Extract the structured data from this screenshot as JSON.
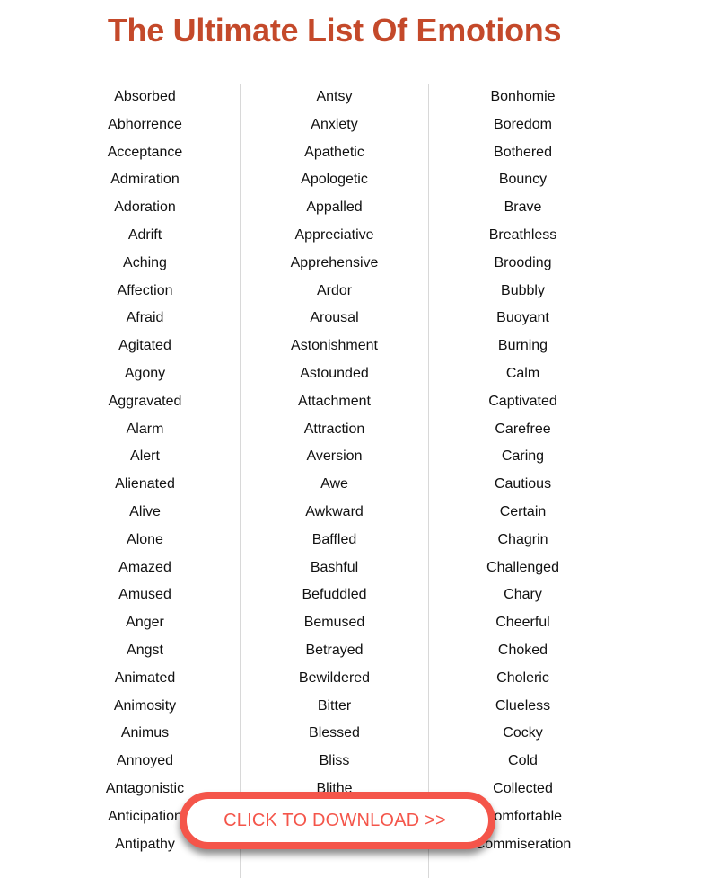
{
  "header": {
    "title": "The Ultimate List Of Emotions",
    "title_color": "#C4492A"
  },
  "columns": [
    {
      "words": [
        "Absorbed",
        "Abhorrence",
        "Acceptance",
        "Admiration",
        "Adoration",
        "Adrift",
        "Aching",
        "Affection",
        "Afraid",
        "Agitated",
        "Agony",
        "Aggravated",
        "Alarm",
        "Alert",
        "Alienated",
        "Alive",
        "Alone",
        "Amazed",
        "Amused",
        "Anger",
        "Angst",
        "Animated",
        "Animosity",
        "Animus",
        "Annoyed",
        "Antagonistic",
        "Anticipation",
        "Antipathy"
      ]
    },
    {
      "words": [
        "Antsy",
        "Anxiety",
        "Apathetic",
        "Apologetic",
        "Appalled",
        "Appreciative",
        "Apprehensive",
        "Ardor",
        "Arousal",
        "Astonishment",
        "Astounded",
        "Attachment",
        "Attraction",
        "Aversion",
        "Awe",
        "Awkward",
        "Baffled",
        "Bashful",
        "Befuddled",
        "Bemused",
        "Betrayed",
        "Bewildered",
        "Bitter",
        "Blessed",
        "Bliss",
        "Blithe"
      ]
    },
    {
      "words": [
        "Bonhomie",
        "Boredom",
        "Bothered",
        "Bouncy",
        "Brave",
        "Breathless",
        "Brooding",
        "Bubbly",
        "Buoyant",
        "Burning",
        "Calm",
        "Captivated",
        "Carefree",
        "Caring",
        "Cautious",
        "Certain",
        "Chagrin",
        "Challenged",
        "Chary",
        "Cheerful",
        "Choked",
        "Choleric",
        "Clueless",
        "Cocky",
        "Cold",
        "Collected",
        "Comfortable",
        "Commiseration"
      ]
    }
  ],
  "cta": {
    "label": "CLICK TO DOWNLOAD >>",
    "color": "#F4554A"
  }
}
